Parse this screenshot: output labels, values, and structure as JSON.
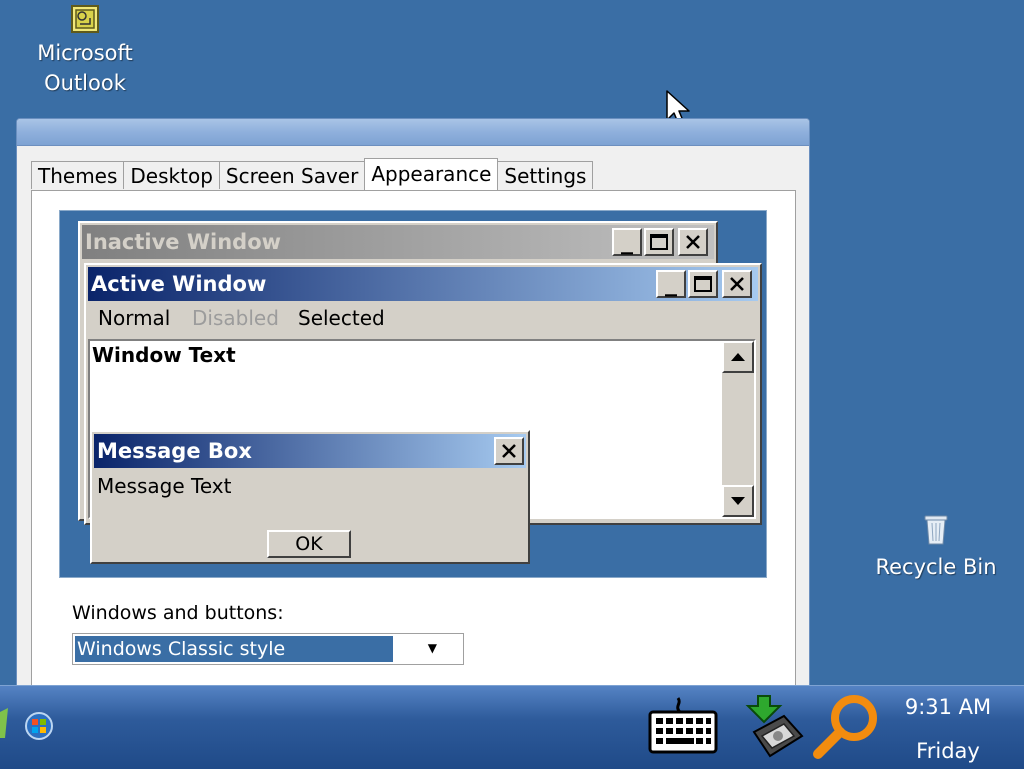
{
  "desktop": {
    "icons": [
      {
        "label_line1": "Microsoft",
        "label_line2": "Outlook",
        "icon": "outlook-icon"
      },
      {
        "label": "Recycle Bin",
        "icon": "recycle-bin-icon"
      }
    ]
  },
  "dialog": {
    "tabs": [
      {
        "label": "Themes"
      },
      {
        "label": "Desktop"
      },
      {
        "label": "Screen Saver"
      },
      {
        "label": "Appearance",
        "active": true
      },
      {
        "label": "Settings"
      }
    ],
    "preview": {
      "inactive_title": "Inactive Window",
      "active_title": "Active Window",
      "menu": {
        "normal": "Normal",
        "disabled": "Disabled",
        "selected": "Selected"
      },
      "window_text": "Window Text",
      "message_box_title": "Message Box",
      "message_text": "Message Text",
      "ok_label": "OK"
    },
    "windows_and_buttons_label": "Windows and buttons:",
    "windows_and_buttons_value": "Windows Classic style"
  },
  "taskbar": {
    "time": "9:31 AM",
    "day": "Friday",
    "tray_icons": [
      "keyboard-icon",
      "network-icon",
      "search-icon"
    ]
  },
  "colors": {
    "desktop": "#3a6ea5",
    "active_title_start": "#0a246a",
    "active_title_end": "#a6caf0",
    "inactive_title_start": "#808080",
    "inactive_title_end": "#c0c0c0",
    "face": "#d4d0c8",
    "selection": "#3a6ea5"
  }
}
